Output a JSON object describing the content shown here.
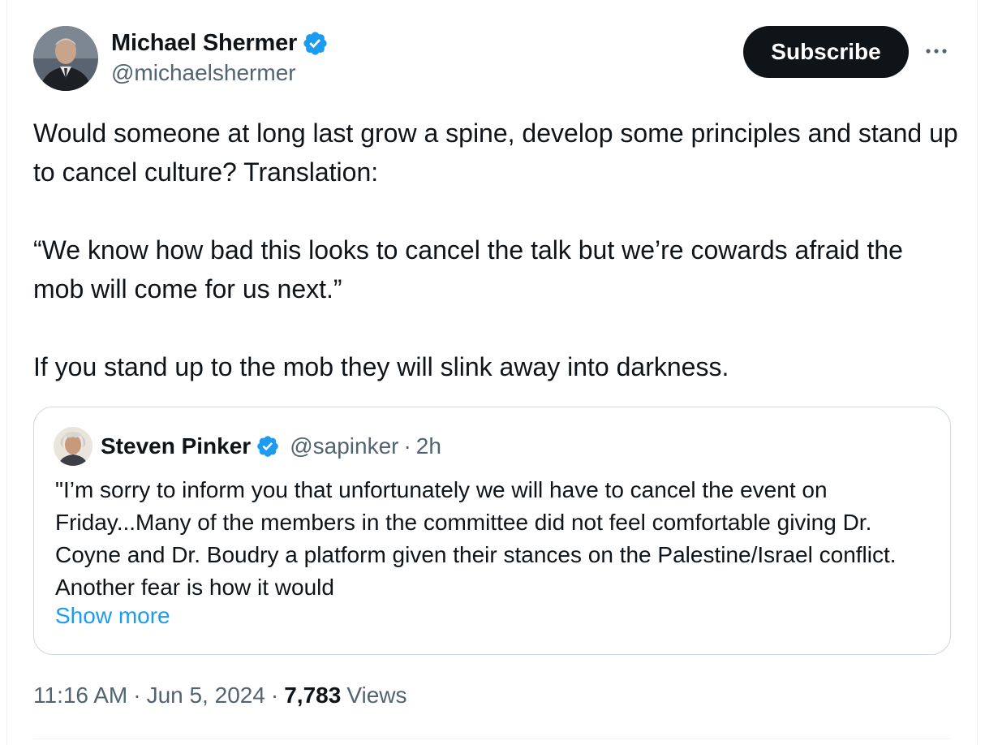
{
  "author": {
    "name": "Michael Shermer",
    "handle": "@michaelshermer",
    "verified_color": "#1d9bf0"
  },
  "actions": {
    "subscribe_label": "Subscribe",
    "more_icon": "more-horizontal-icon"
  },
  "tweet": {
    "paragraphs": [
      "Would someone at long last grow a spine, develop some principles and stand up to cancel culture? Translation:",
      "“We know how bad this looks to cancel the talk but we’re cowards afraid the mob will come for us next.”",
      "If you stand up to the mob they will slink away into darkness."
    ]
  },
  "quoted": {
    "name": "Steven Pinker",
    "handle": "@sapinker",
    "separator": "·",
    "time": "2h",
    "text": "\"I’m sorry to inform you that unfortunately we will have to cancel the event on Friday...Many of the members in the committee did not feel comfortable giving Dr. Coyne and Dr. Boudry a platform given their stances on the Palestine/Israel conflict. Another fear is how it would",
    "show_more": "Show more"
  },
  "meta": {
    "time": "11:16 AM",
    "date": "Jun 5, 2024",
    "separator": "·",
    "views_count": "7,783",
    "views_label": "Views"
  },
  "colors": {
    "text_primary": "#0f1419",
    "text_secondary": "#536471",
    "accent": "#1d9bf0",
    "border": "#cfd9de",
    "button_bg": "#0f1419"
  }
}
